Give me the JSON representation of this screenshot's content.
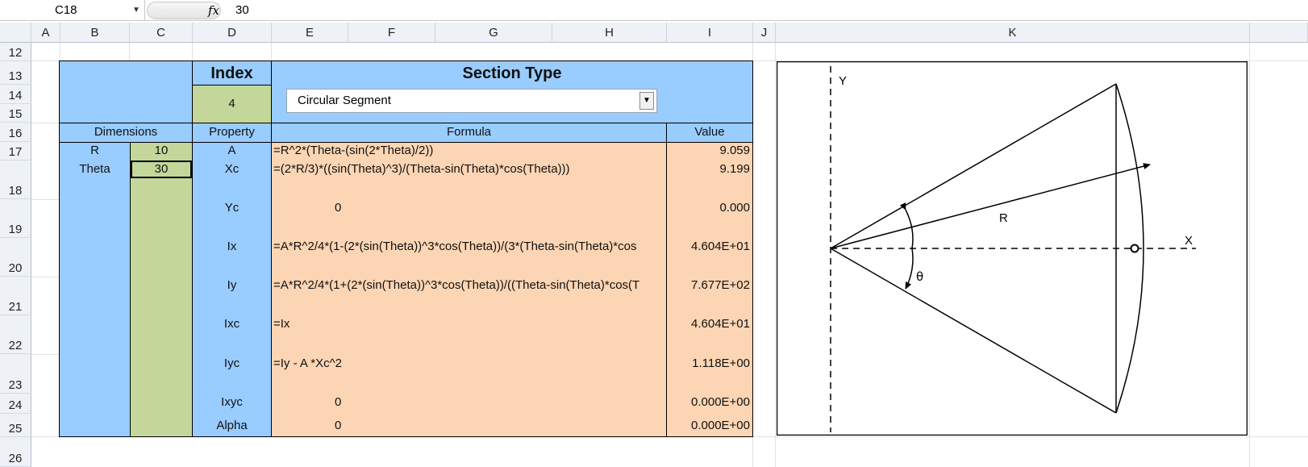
{
  "formula_bar": {
    "name_box": "C18",
    "fx_label": "fx",
    "value": "30"
  },
  "columns": [
    "A",
    "B",
    "C",
    "D",
    "E",
    "F",
    "G",
    "H",
    "I",
    "J",
    "K"
  ],
  "rows": [
    "12",
    "13",
    "14",
    "15",
    "16",
    "17",
    "18",
    "19",
    "20",
    "21",
    "22",
    "23",
    "24",
    "25",
    "26"
  ],
  "table": {
    "index_label": "Index",
    "index_value": "4",
    "section_type_label": "Section Type",
    "section_type_selected": "Circular Segment",
    "headers": {
      "dimensions": "Dimensions",
      "property": "Property",
      "formula": "Formula",
      "value": "Value"
    },
    "dimensions": [
      {
        "name": "R",
        "value": "10"
      },
      {
        "name": "Theta",
        "value": "30"
      }
    ],
    "properties": [
      {
        "name": "A",
        "formula": "=R^2*(Theta-(sin(2*Theta)/2))",
        "value": "9.059"
      },
      {
        "name": "Xc",
        "formula": "=(2*R/3)*((sin(Theta)^3)/(Theta-sin(Theta)*cos(Theta)))",
        "value": "9.199"
      },
      {
        "name": "Yc",
        "formula": "0",
        "value": "0.000"
      },
      {
        "name": "Ix",
        "formula": "=A*R^2/4*(1-(2*(sin(Theta))^3*cos(Theta))/(3*(Theta-sin(Theta)*cos",
        "value": "4.604E+01"
      },
      {
        "name": "Iy",
        "formula": "=A*R^2/4*(1+(2*(sin(Theta))^3*cos(Theta))/((Theta-sin(Theta)*cos(T",
        "value": "7.677E+02"
      },
      {
        "name": "Ixc",
        "formula": "=Ix",
        "value": "4.604E+01"
      },
      {
        "name": "Iyc",
        "formula": "=Iy - A *Xc^2",
        "value": "1.118E+00"
      },
      {
        "name": "Ixyc",
        "formula": "0",
        "value": "0.000E+00"
      },
      {
        "name": "Alpha",
        "formula": "0",
        "value": "0.000E+00"
      }
    ]
  },
  "diagram": {
    "y_label": "Y",
    "x_label": "X",
    "r_label": "R",
    "theta_label": "θ"
  },
  "icons": {
    "dropdown": "chevron-down-icon",
    "function": "fx-icon"
  }
}
